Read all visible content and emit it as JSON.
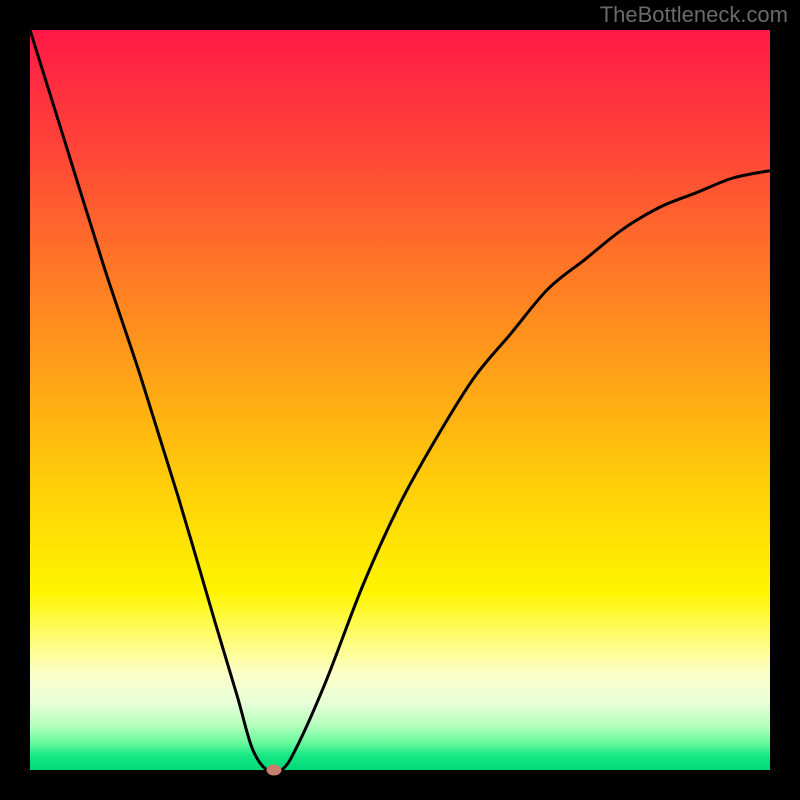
{
  "watermark": "TheBottleneck.com",
  "chart_data": {
    "type": "line",
    "title": "",
    "xlabel": "",
    "ylabel": "",
    "xlim": [
      0,
      100
    ],
    "ylim": [
      0,
      100
    ],
    "background_gradient": {
      "top": "#ff1846",
      "bottom": "#00d97a",
      "meaning": "red-high to green-low bottleneck severity"
    },
    "series": [
      {
        "name": "bottleneck-curve",
        "x": [
          0,
          5,
          10,
          15,
          20,
          25,
          28,
          30,
          32,
          34,
          36,
          40,
          45,
          50,
          55,
          60,
          65,
          70,
          75,
          80,
          85,
          90,
          95,
          100
        ],
        "values": [
          100,
          84,
          68,
          53,
          37,
          20,
          10,
          3,
          0,
          0,
          3,
          12,
          25,
          36,
          45,
          53,
          59,
          65,
          69,
          73,
          76,
          78,
          80,
          81
        ]
      }
    ],
    "marker": {
      "name": "optimal-point",
      "x": 33,
      "y": 0
    }
  }
}
